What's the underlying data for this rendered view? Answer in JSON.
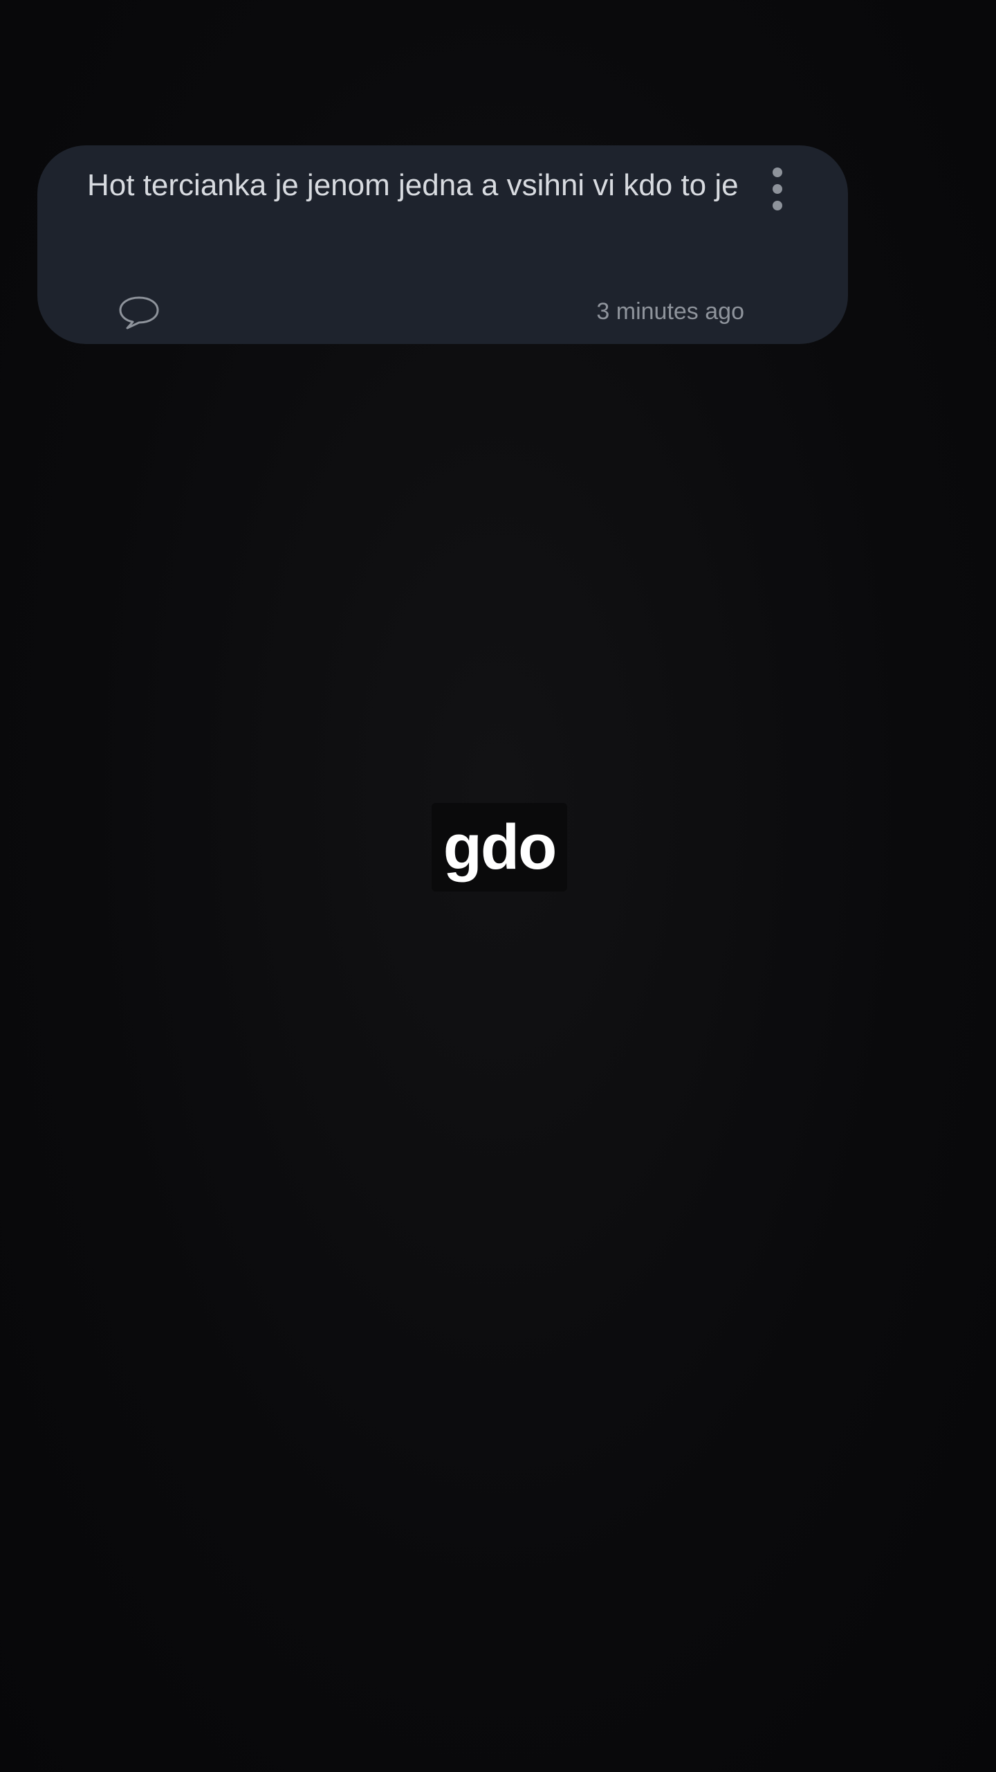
{
  "post": {
    "text": "Hot tercianka je jenom jedna a vsihni vi kdo to je",
    "timestamp": "3 minutes ago",
    "icons": {
      "more": "more-vertical-icon",
      "comment": "comment-bubble-icon"
    }
  },
  "sticker": {
    "text": "gdo"
  },
  "colors": {
    "background": "#0b0b0d",
    "card": "#1e232d",
    "post_text": "#d8dbe0",
    "muted": "#8f949c",
    "sticker_text": "#ffffff"
  }
}
